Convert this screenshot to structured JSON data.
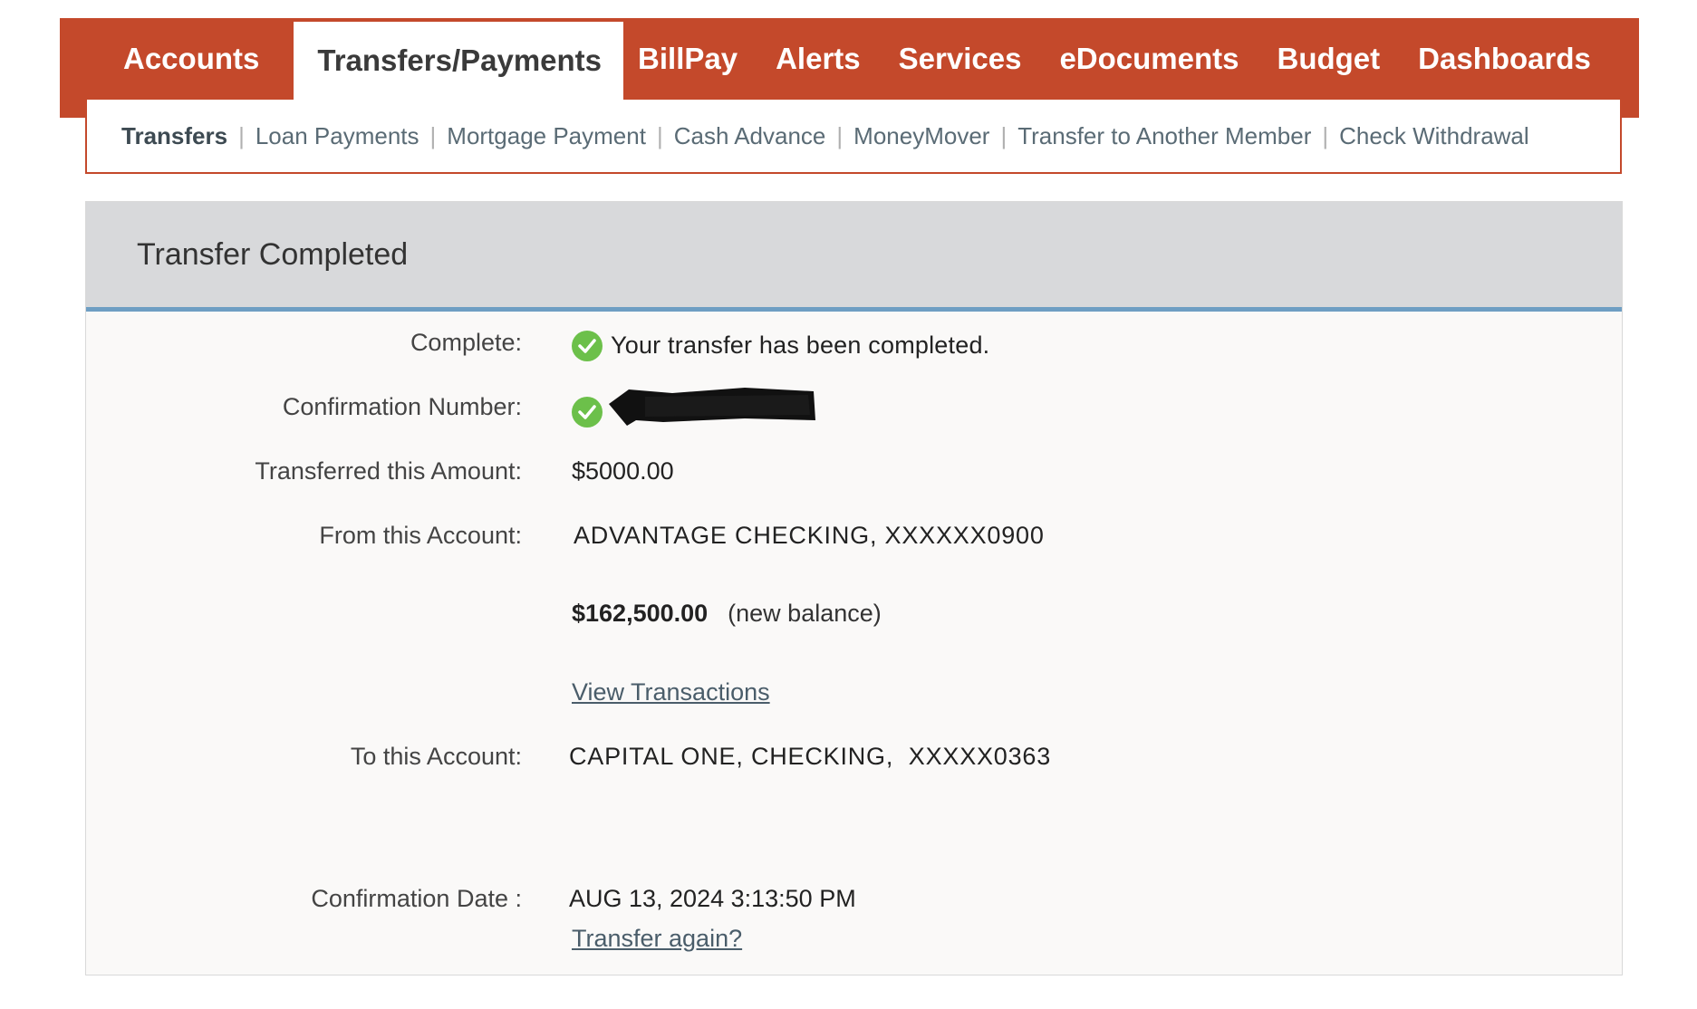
{
  "topnav": {
    "items": [
      {
        "label": "Accounts"
      },
      {
        "label": "Transfers/Payments"
      },
      {
        "label": "BillPay"
      },
      {
        "label": "Alerts"
      },
      {
        "label": "Services"
      },
      {
        "label": "eDocuments"
      },
      {
        "label": "Budget"
      },
      {
        "label": "Dashboards"
      }
    ],
    "active": "Transfers/Payments"
  },
  "subnav": {
    "items": [
      {
        "label": "Transfers"
      },
      {
        "label": "Loan Payments"
      },
      {
        "label": "Mortgage Payment"
      },
      {
        "label": "Cash Advance"
      },
      {
        "label": "MoneyMover"
      },
      {
        "label": "Transfer to Another Member"
      },
      {
        "label": "Check Withdrawal"
      }
    ],
    "active": "Transfers",
    "separator": "|"
  },
  "panel": {
    "title": "Transfer Completed",
    "rows": {
      "complete": {
        "label": "Complete:",
        "value": "Your transfer has been completed."
      },
      "confirmation_number": {
        "label": "Confirmation Number:"
      },
      "amount": {
        "label": "Transferred this Amount:",
        "value": "$5000.00"
      },
      "from_account": {
        "label": "From this Account:",
        "value": "ADVANTAGE CHECKING, XXXXXX0900"
      },
      "new_balance": {
        "amount": "$162,500.00",
        "note": "(new balance)"
      },
      "view_transactions": {
        "label": "View Transactions"
      },
      "to_account": {
        "label": "To this Account:",
        "value": "CAPITAL ONE, CHECKING,  XXXXX0363"
      },
      "confirmation_date": {
        "label": "Confirmation Date :",
        "value": "AUG 13, 2024 3:13:50 PM"
      },
      "transfer_again": {
        "label": "Transfer again?"
      }
    }
  },
  "colors": {
    "brand": "#c4492b",
    "header_bg": "#d8d9db",
    "header_rule": "#6e9ec3",
    "success": "#6cc04a",
    "panel_bg": "#faf9f8"
  },
  "icons": {
    "complete": "check-circle-icon",
    "confirmation": "check-circle-icon"
  }
}
